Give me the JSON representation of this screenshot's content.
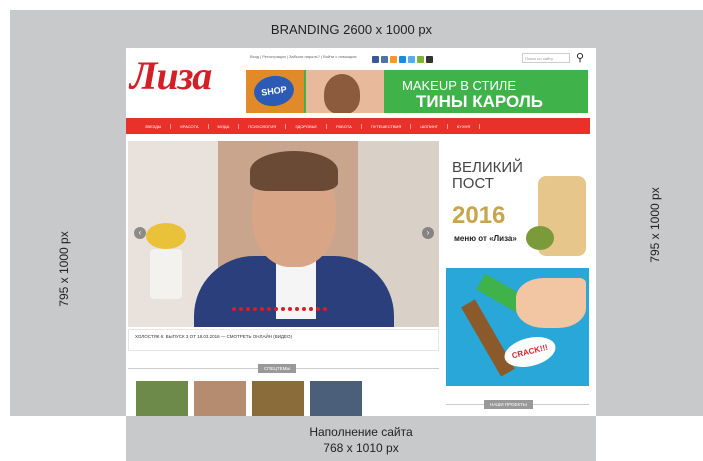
{
  "layout": {
    "branding_label": "BRANDING 2600 x 1000 px",
    "left_label": "795 x 1000 px",
    "right_label": "795 x 1000 px",
    "content_label_line1": "Наполнение сайта",
    "content_label_line2": "768 x 1010 px"
  },
  "site": {
    "logo": "Лиза",
    "top_links": "Вход | Регистрация | Забыли пароль? | Войти с помощью:",
    "search_placeholder": "Поиск по сайту",
    "search_icon": "magnifier-icon",
    "banner": {
      "badge": "SHOP",
      "line1": "MAKEUP В СТИЛЕ",
      "line2": "ТИНЫ КАРОЛЬ"
    },
    "nav": [
      "ЗВЕЗДЫ",
      "КРАСОТА",
      "МОДА",
      "ПСИХОЛОГИЯ",
      "ЗДОРОВЬЕ",
      "РАБОТА",
      "ПУТЕШЕСТВИЯ",
      "ШОПИНГ",
      "КУХНЯ"
    ],
    "hero_caption": "ХОЛОСТЯК 6: ВЫПУСК 3 ОТ 18.03.2016 — СМОТРЕТЬ ОНЛАЙН (ВИДЕО)",
    "promo": {
      "line1": "ВЕЛИКИЙ",
      "line2": "ПОСТ",
      "year": "2016",
      "subtitle": "меню от «Лиза»"
    },
    "ad_text": "CRACK!!!",
    "section_label": "СПЕЦТЕМЫ",
    "projects_label": "НАШИ ПРОЕКТЫ"
  },
  "colors": {
    "accent": "#d31f26",
    "nav": "#e8312a",
    "banner_green": "#3fb34a",
    "ad_blue": "#29a7d8"
  }
}
